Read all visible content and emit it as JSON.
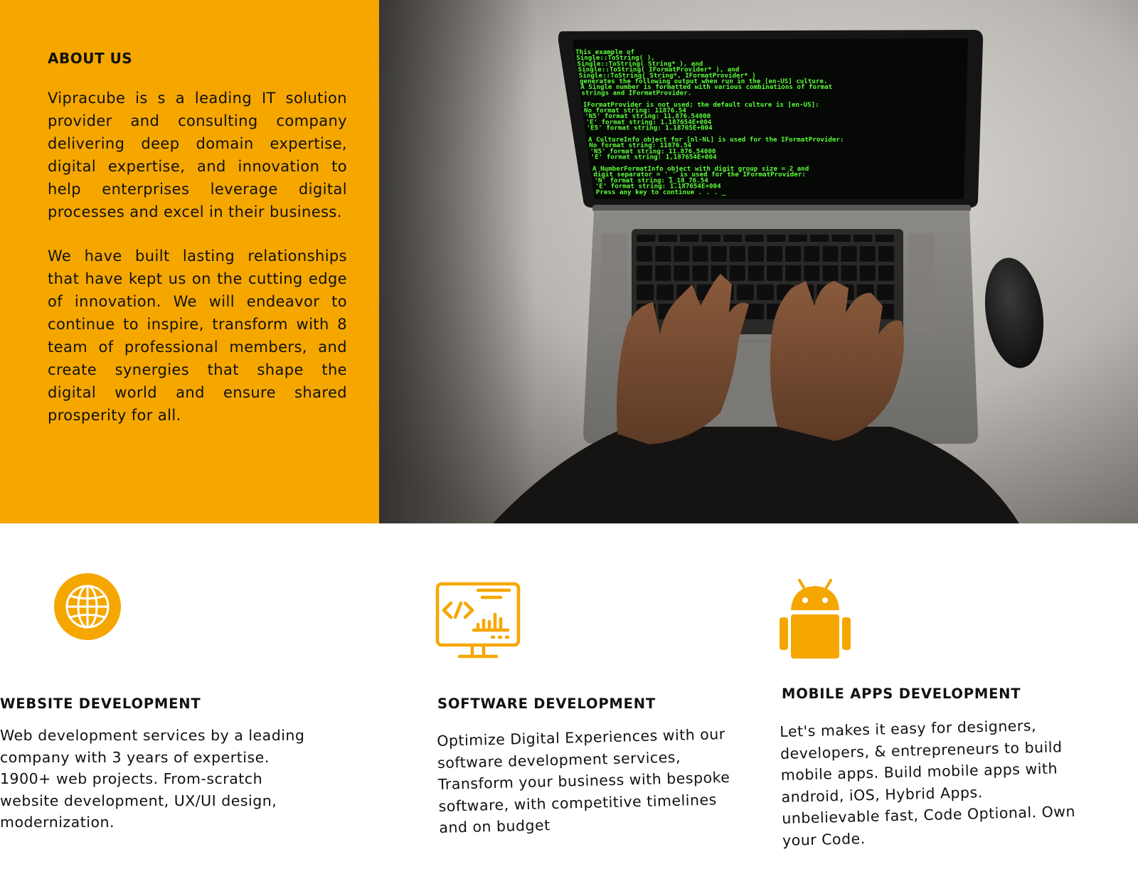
{
  "about": {
    "title": "ABOUT US",
    "paragraph1": "Vipracube is s a leading IT solution provider and consulting company delivering deep domain expertise, digital expertise, and innovation to help enterprises leverage digital processes and excel in their business.",
    "paragraph2": "We have built lasting relationships that have kept us on the cutting edge of innovation. We will endeavor to continue to inspire, transform with 8 team of professional members, and create synergies that shape the digital world and ensure shared prosperity for all."
  },
  "services": [
    {
      "icon": "globe-icon",
      "title": "WEBSITE DEVELOPMENT",
      "text": "Web development services by a leading company with 3 years of expertise. 1900+ web projects. From-scratch website development, UX/UI design, modernization."
    },
    {
      "icon": "code-monitor-icon",
      "title": "SOFTWARE DEVELOPMENT",
      "text": "Optimize Digital Experiences with our software development services, Transform your business with bespoke software, with competitive timelines and on budget"
    },
    {
      "icon": "android-icon",
      "title": "MOBILE APPS DEVELOPMENT",
      "text": "Let's makes it easy for designers, developers, & entrepreneurs to build mobile apps. Build mobile apps with android, iOS, Hybrid Apps. unbelievable fast, Code Optional. Own your Code."
    }
  ],
  "screen_code": [
    "This example of",
    "  Single::ToString( ),",
    "  Single::ToString( String* ), and",
    "  Single::ToString( IFormatProvider* ), and",
    "  Single::ToString( String*, IFormatProvider* )",
    "generates the following output when run in the [en-US] culture.",
    "A Single number is formatted with various combinations of format",
    "strings and IFormatProvider.",
    "",
    "IFormatProvider is not used; the default culture is [en-US]:",
    "   No format string:              11876.54",
    "   'N5' format string:            11,876.54000",
    "   'E' format string:             1.187654E+004",
    "   'E5' format string:            1.18765E+004",
    "",
    "A CultureInfo object for [nl-NL] is used for the IFormatProvider:",
    "   No format string:              11876.54",
    "   'N5' format string:            11.876,54000",
    "   'E' format string:             1,187654E+004",
    "",
    "A NumberFormatInfo object with digit group size = 2 and",
    "digit separator = '_' is used for the IFormatProvider:",
    "   'N' format string:             1_18_76.54",
    "   'E' format string:             1.187654E+004",
    "Press any key to continue . . . _"
  ],
  "colors": {
    "accent": "#f5a700",
    "terminal_green": "#5cff3a"
  }
}
